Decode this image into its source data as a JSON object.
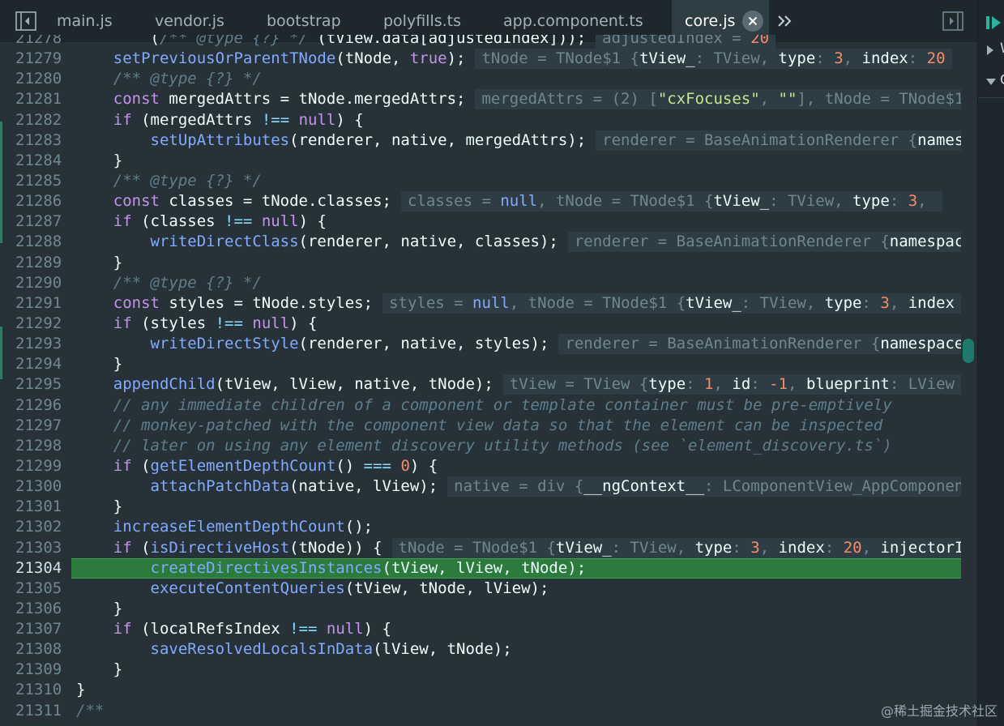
{
  "tabs": [
    {
      "label": "main.js",
      "active": false
    },
    {
      "label": "vendor.js",
      "active": false
    },
    {
      "label": "bootstrap",
      "active": false
    },
    {
      "label": "polyfills.ts",
      "active": false
    },
    {
      "label": "app.component.ts",
      "active": false
    },
    {
      "label": "core.js",
      "active": true
    }
  ],
  "icons": {
    "toggle_navigator": "sidebar-left-icon",
    "more_tabs": "chevron-double-right-icon",
    "close_tab": "close-icon",
    "toggle_debugger": "sidebar-right-icon",
    "resume": "resume-icon",
    "expand": "chevron-right-icon",
    "collapse": "chevron-down-icon"
  },
  "side_panel": {
    "row1_text": "W",
    "row2_text": "C"
  },
  "colors": {
    "background": "#263238",
    "keyword": "#c792ea",
    "function": "#82aaff",
    "number": "#f78c6c",
    "comment": "#607d8b",
    "string": "#c3e88d",
    "current_line": "#2c7a3c"
  },
  "editor": {
    "current_line": "21304",
    "lines": [
      {
        "n": "21278",
        "t": [
          [
            "pl",
            "        ("
          ],
          [
            "cm",
            "/** @type {?} */"
          ],
          [
            "pl",
            " (tView.data[adjustedIndex]));"
          ]
        ],
        "hint": [
          [
            "ik",
            "adjustedIndex = "
          ],
          [
            "in",
            "20"
          ]
        ]
      },
      {
        "n": "21279",
        "t": [
          [
            "pl",
            "    "
          ],
          [
            "fn",
            "setPreviousOrParentTNode"
          ],
          [
            "pl",
            "(tNode, "
          ],
          [
            "kw",
            "true"
          ],
          [
            "pl",
            ");"
          ]
        ],
        "hint": [
          [
            "ik",
            "tNode = TNode$1 {"
          ],
          [
            "iv",
            "tView_"
          ],
          [
            "ik",
            ": TView, "
          ],
          [
            "iv",
            "type"
          ],
          [
            "ik",
            ": "
          ],
          [
            "in",
            "3"
          ],
          [
            "ik",
            ", "
          ],
          [
            "iv",
            "index"
          ],
          [
            "ik",
            ": "
          ],
          [
            "in",
            "20"
          ]
        ]
      },
      {
        "n": "21280",
        "t": [
          [
            "pl",
            "    "
          ],
          [
            "cm",
            "/** @type {?} */"
          ]
        ]
      },
      {
        "n": "21281",
        "t": [
          [
            "pl",
            "    "
          ],
          [
            "kw",
            "const"
          ],
          [
            "pl",
            " mergedAttrs = tNode.mergedAttrs;"
          ]
        ],
        "hint": [
          [
            "ik",
            "mergedAttrs = (2) ["
          ],
          [
            "is",
            "\"cxFocuses\""
          ],
          [
            "ik",
            ", "
          ],
          [
            "is",
            "\"\""
          ],
          [
            "ik",
            "], tNode = TNode$1"
          ]
        ]
      },
      {
        "n": "21282",
        "t": [
          [
            "pl",
            "    "
          ],
          [
            "kw",
            "if"
          ],
          [
            "pl",
            " (mergedAttrs "
          ],
          [
            "op",
            "!=="
          ],
          [
            "pl",
            " "
          ],
          [
            "kw",
            "null"
          ],
          [
            "pl",
            ") {"
          ]
        ]
      },
      {
        "n": "21283",
        "t": [
          [
            "pl",
            "        "
          ],
          [
            "fn",
            "setUpAttributes"
          ],
          [
            "pl",
            "(renderer, native, mergedAttrs);"
          ]
        ],
        "hint": [
          [
            "ik",
            "renderer = BaseAnimationRenderer {"
          ],
          [
            "iv",
            "namespaceId"
          ]
        ]
      },
      {
        "n": "21284",
        "t": [
          [
            "pl",
            "    }"
          ]
        ]
      },
      {
        "n": "21285",
        "t": [
          [
            "pl",
            "    "
          ],
          [
            "cm",
            "/** @type {?} */"
          ]
        ]
      },
      {
        "n": "21286",
        "t": [
          [
            "pl",
            "    "
          ],
          [
            "kw",
            "const"
          ],
          [
            "pl",
            " classes = tNode.classes;"
          ]
        ],
        "hint": [
          [
            "ik",
            "classes = "
          ],
          [
            "ib",
            "null"
          ],
          [
            "ik",
            ", tNode = TNode$1 {"
          ],
          [
            "iv",
            "tView_"
          ],
          [
            "ik",
            ": TView, "
          ],
          [
            "iv",
            "type"
          ],
          [
            "ik",
            ": "
          ],
          [
            "in",
            "3"
          ],
          [
            "ik",
            ", "
          ]
        ]
      },
      {
        "n": "21287",
        "t": [
          [
            "pl",
            "    "
          ],
          [
            "kw",
            "if"
          ],
          [
            "pl",
            " (classes "
          ],
          [
            "op",
            "!=="
          ],
          [
            "pl",
            " "
          ],
          [
            "kw",
            "null"
          ],
          [
            "pl",
            ") {"
          ]
        ]
      },
      {
        "n": "21288",
        "t": [
          [
            "pl",
            "        "
          ],
          [
            "fn",
            "writeDirectClass"
          ],
          [
            "pl",
            "(renderer, native, classes);"
          ]
        ],
        "hint": [
          [
            "ik",
            "renderer = BaseAnimationRenderer {"
          ],
          [
            "iv",
            "namespaceId"
          ]
        ]
      },
      {
        "n": "21289",
        "t": [
          [
            "pl",
            "    }"
          ]
        ]
      },
      {
        "n": "21290",
        "t": [
          [
            "pl",
            "    "
          ],
          [
            "cm",
            "/** @type {?} */"
          ]
        ]
      },
      {
        "n": "21291",
        "t": [
          [
            "pl",
            "    "
          ],
          [
            "kw",
            "const"
          ],
          [
            "pl",
            " styles = tNode.styles;"
          ]
        ],
        "hint": [
          [
            "ik",
            "styles = "
          ],
          [
            "ib",
            "null"
          ],
          [
            "ik",
            ", tNode = TNode$1 {"
          ],
          [
            "iv",
            "tView_"
          ],
          [
            "ik",
            ": TView, "
          ],
          [
            "iv",
            "type"
          ],
          [
            "ik",
            ": "
          ],
          [
            "in",
            "3"
          ],
          [
            "ik",
            ", "
          ],
          [
            "iv",
            "index"
          ]
        ]
      },
      {
        "n": "21292",
        "t": [
          [
            "pl",
            "    "
          ],
          [
            "kw",
            "if"
          ],
          [
            "pl",
            " (styles "
          ],
          [
            "op",
            "!=="
          ],
          [
            "pl",
            " "
          ],
          [
            "kw",
            "null"
          ],
          [
            "pl",
            ") {"
          ]
        ]
      },
      {
        "n": "21293",
        "t": [
          [
            "pl",
            "        "
          ],
          [
            "fn",
            "writeDirectStyle"
          ],
          [
            "pl",
            "(renderer, native, styles);"
          ]
        ],
        "hint": [
          [
            "ik",
            "renderer = BaseAnimationRenderer {"
          ],
          [
            "iv",
            "namespaceId"
          ]
        ]
      },
      {
        "n": "21294",
        "t": [
          [
            "pl",
            "    }"
          ]
        ]
      },
      {
        "n": "21295",
        "t": [
          [
            "pl",
            "    "
          ],
          [
            "fn",
            "appendChild"
          ],
          [
            "pl",
            "(tView, lView, native, tNode);"
          ]
        ],
        "hint": [
          [
            "ik",
            "tView = TView {"
          ],
          [
            "iv",
            "type"
          ],
          [
            "ik",
            ": "
          ],
          [
            "in",
            "1"
          ],
          [
            "ik",
            ", "
          ],
          [
            "iv",
            "id"
          ],
          [
            "ik",
            ": "
          ],
          [
            "in",
            "-1"
          ],
          [
            "ik",
            ", "
          ],
          [
            "iv",
            "blueprint"
          ],
          [
            "ik",
            ": LView"
          ]
        ]
      },
      {
        "n": "21296",
        "t": [
          [
            "pl",
            "    "
          ],
          [
            "cm",
            "// any immediate children of a component or template container must be pre-emptively"
          ]
        ]
      },
      {
        "n": "21297",
        "t": [
          [
            "pl",
            "    "
          ],
          [
            "cm",
            "// monkey-patched with the component view data so that the element can be inspected"
          ]
        ]
      },
      {
        "n": "21298",
        "t": [
          [
            "pl",
            "    "
          ],
          [
            "cm",
            "// later on using any element discovery utility methods (see `element_discovery.ts`)"
          ]
        ]
      },
      {
        "n": "21299",
        "t": [
          [
            "pl",
            "    "
          ],
          [
            "kw",
            "if"
          ],
          [
            "pl",
            " ("
          ],
          [
            "fn",
            "getElementDepthCount"
          ],
          [
            "pl",
            "() "
          ],
          [
            "op",
            "==="
          ],
          [
            "pl",
            " "
          ],
          [
            "nm",
            "0"
          ],
          [
            "pl",
            ") {"
          ]
        ]
      },
      {
        "n": "21300",
        "t": [
          [
            "pl",
            "        "
          ],
          [
            "fn",
            "attachPatchData"
          ],
          [
            "pl",
            "(native, lView);"
          ]
        ],
        "hint": [
          [
            "ik",
            "native = div {"
          ],
          [
            "iv",
            "__ngContext__"
          ],
          [
            "ik",
            ": LComponentView_AppComponent"
          ]
        ]
      },
      {
        "n": "21301",
        "t": [
          [
            "pl",
            "    }"
          ]
        ]
      },
      {
        "n": "21302",
        "t": [
          [
            "pl",
            "    "
          ],
          [
            "fn",
            "increaseElementDepthCount"
          ],
          [
            "pl",
            "();"
          ]
        ]
      },
      {
        "n": "21303",
        "t": [
          [
            "pl",
            "    "
          ],
          [
            "kw",
            "if"
          ],
          [
            "pl",
            " ("
          ],
          [
            "fn",
            "isDirectiveHost"
          ],
          [
            "pl",
            "(tNode)) {"
          ]
        ],
        "hint": [
          [
            "ik",
            "tNode = TNode$1 {"
          ],
          [
            "iv",
            "tView_"
          ],
          [
            "ik",
            ": TView, "
          ],
          [
            "iv",
            "type"
          ],
          [
            "ik",
            ": "
          ],
          [
            "in",
            "3"
          ],
          [
            "ik",
            ", "
          ],
          [
            "iv",
            "index"
          ],
          [
            "ik",
            ": "
          ],
          [
            "in",
            "20"
          ],
          [
            "ik",
            ", "
          ],
          [
            "iv",
            "injectorIndex"
          ]
        ]
      },
      {
        "n": "21304",
        "t": [
          [
            "pl",
            "        "
          ],
          [
            "fn",
            "createDirectivesInstances"
          ],
          [
            "pl",
            "(tView, lView, tNode);"
          ]
        ]
      },
      {
        "n": "21305",
        "t": [
          [
            "pl",
            "        "
          ],
          [
            "fn",
            "executeContentQueries"
          ],
          [
            "pl",
            "(tView, tNode, lView);"
          ]
        ]
      },
      {
        "n": "21306",
        "t": [
          [
            "pl",
            "    }"
          ]
        ]
      },
      {
        "n": "21307",
        "t": [
          [
            "pl",
            "    "
          ],
          [
            "kw",
            "if"
          ],
          [
            "pl",
            " (localRefsIndex "
          ],
          [
            "op",
            "!=="
          ],
          [
            "pl",
            " "
          ],
          [
            "kw",
            "null"
          ],
          [
            "pl",
            ") {"
          ]
        ]
      },
      {
        "n": "21308",
        "t": [
          [
            "pl",
            "        "
          ],
          [
            "fn",
            "saveResolvedLocalsInData"
          ],
          [
            "pl",
            "(lView, tNode);"
          ]
        ]
      },
      {
        "n": "21309",
        "t": [
          [
            "pl",
            "    }"
          ]
        ]
      },
      {
        "n": "21310",
        "t": [
          [
            "pl",
            "}"
          ]
        ]
      },
      {
        "n": "21311",
        "t": [
          [
            "cm",
            "/**"
          ]
        ]
      }
    ]
  },
  "watermark": "@稀土掘金技术社区"
}
